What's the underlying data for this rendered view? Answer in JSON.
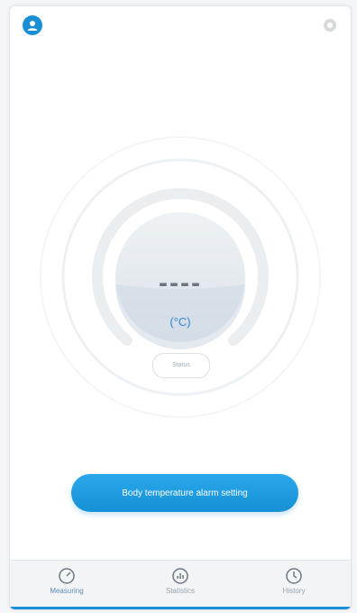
{
  "reading": {
    "value": "----",
    "unit": "(°C)"
  },
  "status": {
    "label": "Status"
  },
  "alarm_button": {
    "label": "Body temperature alarm setting"
  },
  "nav": {
    "items": [
      {
        "label": "Measuring",
        "icon": "gauge-icon"
      },
      {
        "label": "Statistics",
        "icon": "chart-icon"
      },
      {
        "label": "History",
        "icon": "clock-icon"
      }
    ]
  },
  "colors": {
    "accent": "#1a8fd8",
    "unit_text": "#2b87d6"
  }
}
